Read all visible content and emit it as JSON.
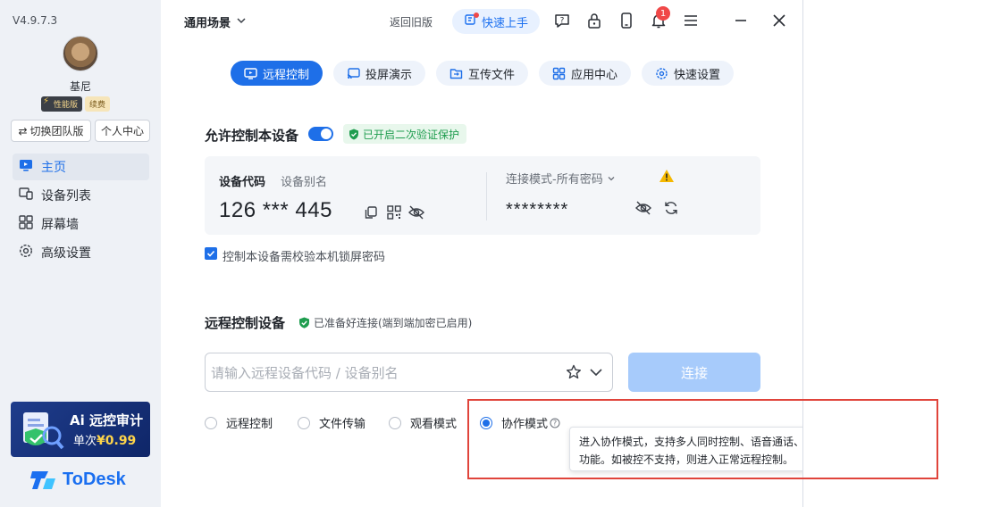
{
  "sidebar": {
    "version": "V4.9.7.3",
    "username": "基尼",
    "badge_perf": "性能版",
    "badge_renew": "续费",
    "switch_team": "切换团队版",
    "personal_center": "个人中心",
    "nav": [
      {
        "label": "主页",
        "icon": "monitor-icon",
        "active": true
      },
      {
        "label": "设备列表",
        "icon": "devices-icon",
        "active": false
      },
      {
        "label": "屏幕墙",
        "icon": "grid-icon",
        "active": false
      },
      {
        "label": "高级设置",
        "icon": "gear-icon",
        "active": false
      }
    ],
    "promo": {
      "title": "Ai 远控审计",
      "sub_prefix": "单次",
      "price": "¥0.99"
    },
    "logo_text": "ToDesk"
  },
  "topbar": {
    "scene": "通用场景",
    "back_old": "返回旧版",
    "quick_start": "快速上手",
    "notification_count": "1"
  },
  "tabs": [
    {
      "label": "远程控制",
      "icon": "monitor-play-icon",
      "active": true
    },
    {
      "label": "投屏演示",
      "icon": "cast-icon",
      "active": false
    },
    {
      "label": "互传文件",
      "icon": "folder-icon",
      "active": false
    },
    {
      "label": "应用中心",
      "icon": "apps-icon",
      "active": false
    },
    {
      "label": "快速设置",
      "icon": "settings-icon",
      "active": false
    }
  ],
  "allow": {
    "title": "允许控制本设备",
    "toggle_on": true,
    "verify_chip": "已开启二次验证保护",
    "code_label": "设备代码",
    "alias_label": "设备别名",
    "code_value": "126 *** 445",
    "mode_label": "连接模式-所有密码",
    "password_value": "********",
    "checkbox_label": "控制本设备需校验本机锁屏密码",
    "checkbox_checked": true
  },
  "remote": {
    "title": "远程控制设备",
    "ready_text": "已准备好连接(端到端加密已启用)",
    "input_placeholder": "请输入远程设备代码 / 设备别名",
    "connect_label": "连接",
    "modes": [
      {
        "label": "远程控制",
        "selected": false
      },
      {
        "label": "文件传输",
        "selected": false
      },
      {
        "label": "观看模式",
        "selected": false
      },
      {
        "label": "协作模式",
        "selected": true
      }
    ],
    "tooltip": "进入协作模式，支持多人同时控制、语音通话、多鼠标与批注等协作功能。如被控不支持，则进入正常远程控制。"
  },
  "colors": {
    "accent": "#1e6fe8",
    "connect_disabled": "#a7cbfb",
    "success": "#1f9d4f",
    "warning": "#f5b800",
    "highlight": "#e0443b"
  }
}
